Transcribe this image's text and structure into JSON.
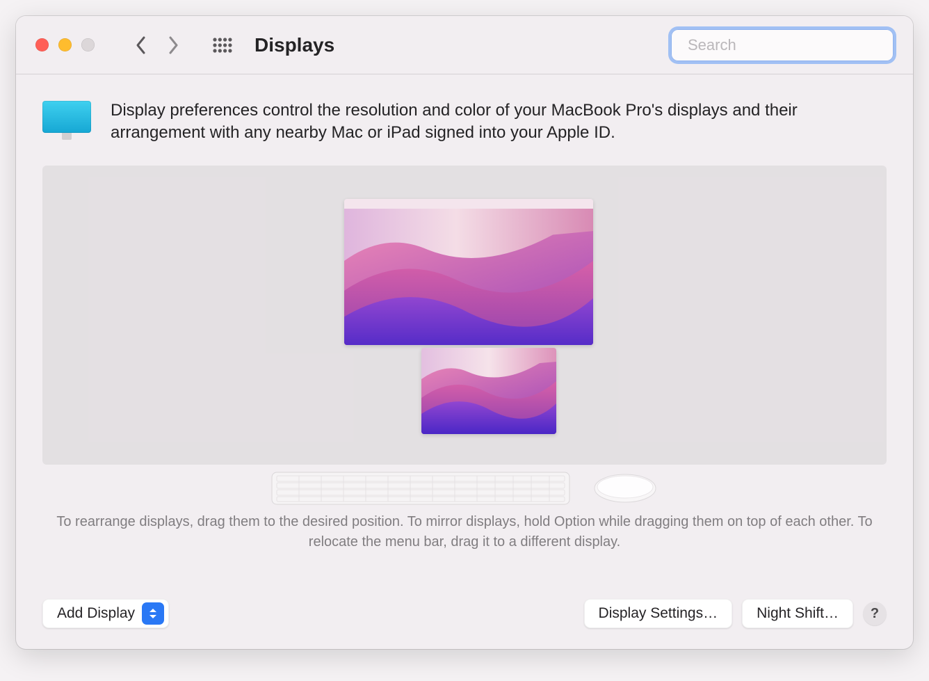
{
  "toolbar": {
    "title": "Displays",
    "search_placeholder": "Search"
  },
  "intro": {
    "text": "Display preferences control the resolution and color of your MacBook Pro's displays and their arrangement with any nearby Mac or iPad signed into your Apple ID."
  },
  "hint": {
    "text": "To rearrange displays, drag them to the desired position. To mirror displays, hold Option while dragging them on top of each other. To relocate the menu bar, drag it to a different display."
  },
  "footer": {
    "add_display": "Add Display",
    "display_settings": "Display Settings…",
    "night_shift": "Night Shift…",
    "help": "?"
  }
}
